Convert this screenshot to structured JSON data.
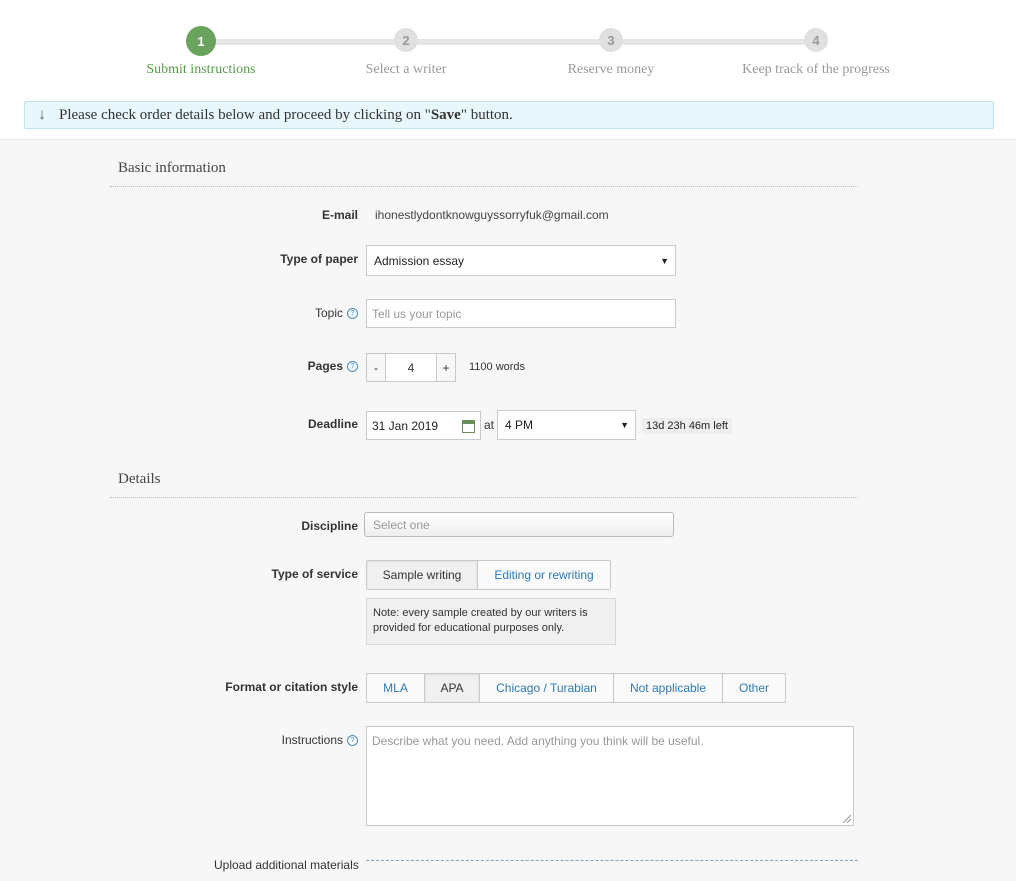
{
  "steps": [
    {
      "number": "1",
      "label": "Submit instructions"
    },
    {
      "number": "2",
      "label": "Select a writer"
    },
    {
      "number": "3",
      "label": "Reserve money"
    },
    {
      "number": "4",
      "label": "Keep track of the progress"
    }
  ],
  "notice": {
    "arrow": "↓",
    "before": "Please check order details below and proceed by clicking on \"",
    "bold": "Save",
    "after": "\" button."
  },
  "basic": {
    "title": "Basic information",
    "email_label": "E-mail",
    "email_value": "ihonestlydontknowguyssorryfuk@gmail.com",
    "paper_label": "Type of paper",
    "paper_value": "Admission essay",
    "topic_label": "Topic",
    "topic_placeholder": "Tell us your topic",
    "pages_label": "Pages",
    "pages_minus": "-",
    "pages_value": "4",
    "pages_plus": "+",
    "words": "1100 words",
    "deadline_label": "Deadline",
    "deadline_date": "31 Jan 2019",
    "deadline_at": "at",
    "deadline_time": "4 PM",
    "time_left": "13d 23h 46m left"
  },
  "details": {
    "title": "Details",
    "discipline_label": "Discipline",
    "discipline_placeholder": "Select one",
    "service_label": "Type of service",
    "service_options": [
      "Sample writing",
      "Editing or rewriting"
    ],
    "service_selected": "Sample writing",
    "note": "Note: every sample created by our writers is provided for educational purposes only.",
    "format_label": "Format or citation style",
    "format_options": [
      "MLA",
      "APA",
      "Chicago / Turabian",
      "Not applicable",
      "Other"
    ],
    "format_selected": "APA",
    "instructions_label": "Instructions",
    "instructions_placeholder": "Describe what you need. Add anything you think will be useful.",
    "upload_label": "Upload additional materials"
  },
  "help_icon": "?",
  "caret": "▼"
}
